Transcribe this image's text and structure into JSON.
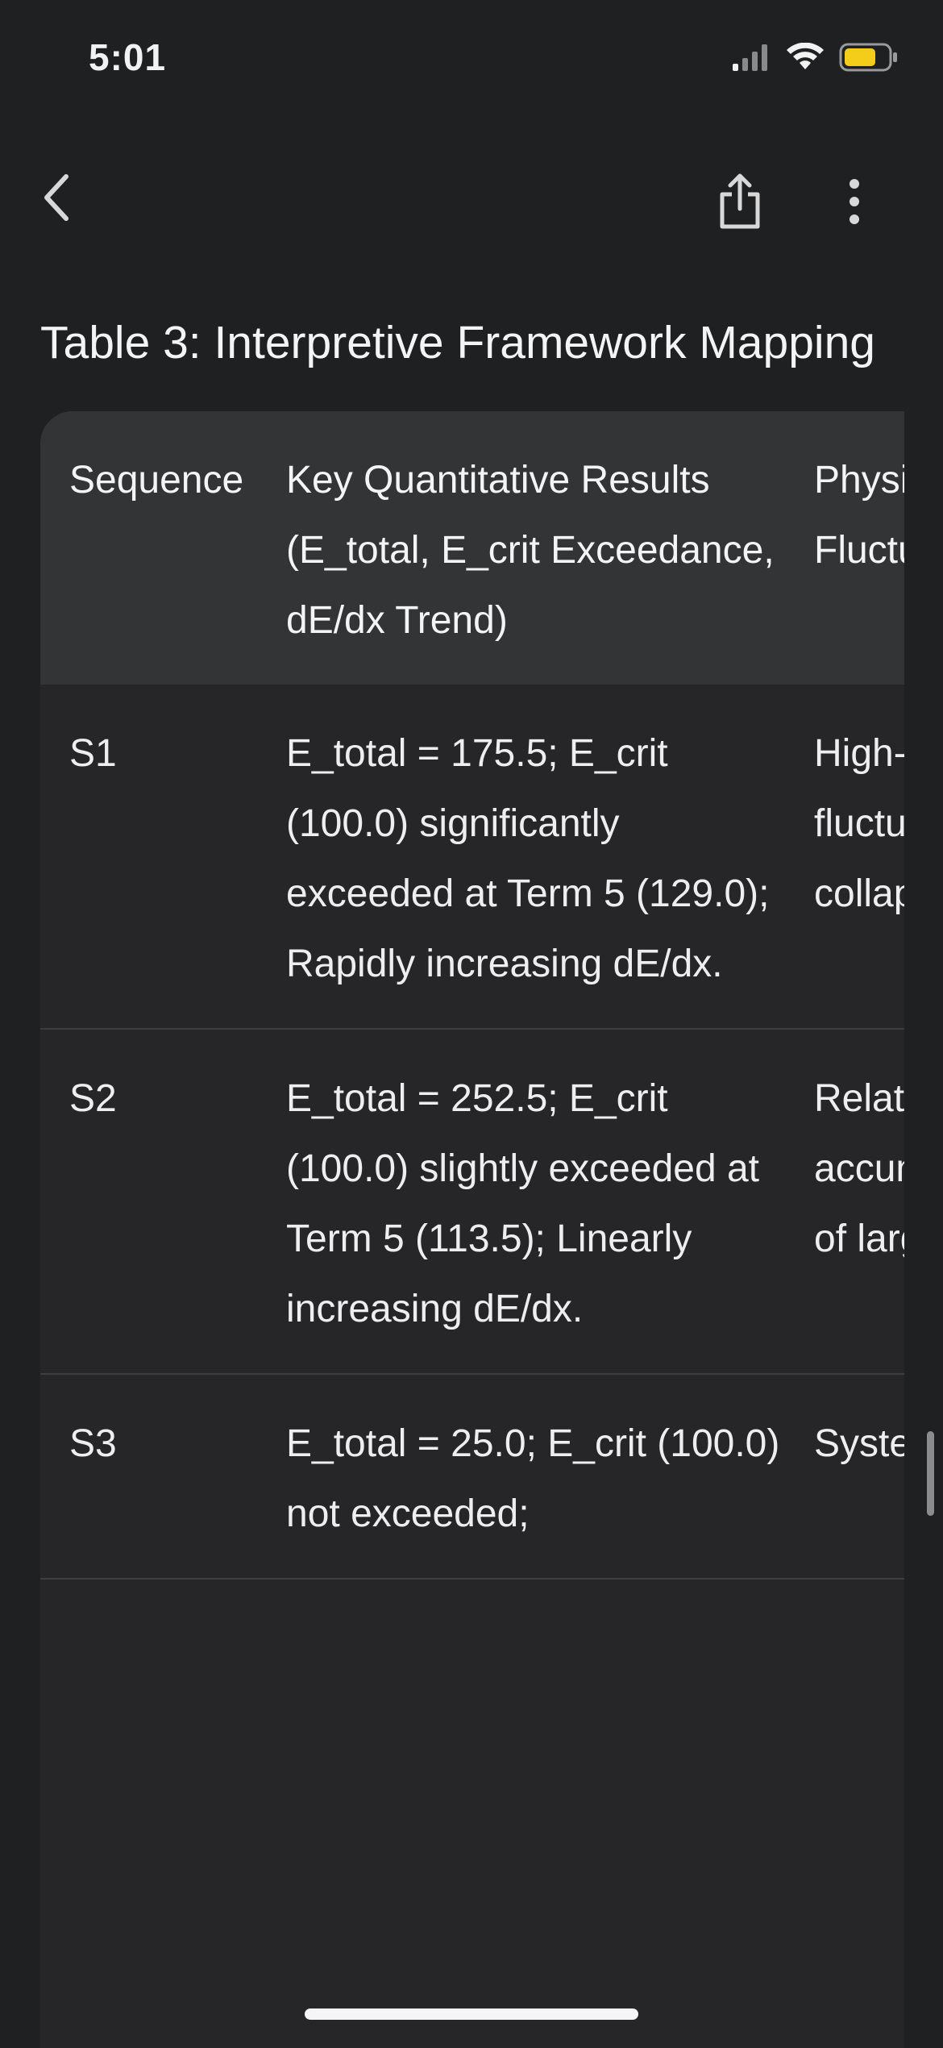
{
  "status_bar": {
    "time": "5:01"
  },
  "toolbar": {
    "back_icon": "chevron-left-icon",
    "share_icon": "share-icon",
    "more_icon": "more-vertical-icon"
  },
  "document": {
    "title": "Table 3: Interpretive Framework Mapping",
    "table": {
      "headers": [
        "Sequence",
        "Key Quantitative Results (E_total, E_crit Exceedance, dE/dx Trend)",
        "Physical Interpretation within Fluctuation Framework"
      ],
      "rows": [
        {
          "sequence": "S1",
          "results": "E_total = 175.5; E_crit (100.0) significantly exceeded at Term 5 (129.0); Rapidly increasing dE/dx.",
          "interpretation": "High-energy process: strong fluctuations promote rapid transition to collapse or runaway."
        },
        {
          "sequence": "S2",
          "results": "E_total = 252.5; E_crit (100.0) slightly exceeded at Term 5 (113.5); Linearly increasing dE/dx.",
          "interpretation": "Relatively resilient configuration: accumulated, sustained perturbation of large magnitude."
        },
        {
          "sequence": "S3",
          "results": "E_total = 25.0; E_crit (100.0) not exceeded;",
          "interpretation": "System configuration"
        }
      ]
    }
  },
  "colors": {
    "background": "#1f2022",
    "table_header": "#333436",
    "table_body": "#262628",
    "battery": "#f4cc1a"
  }
}
